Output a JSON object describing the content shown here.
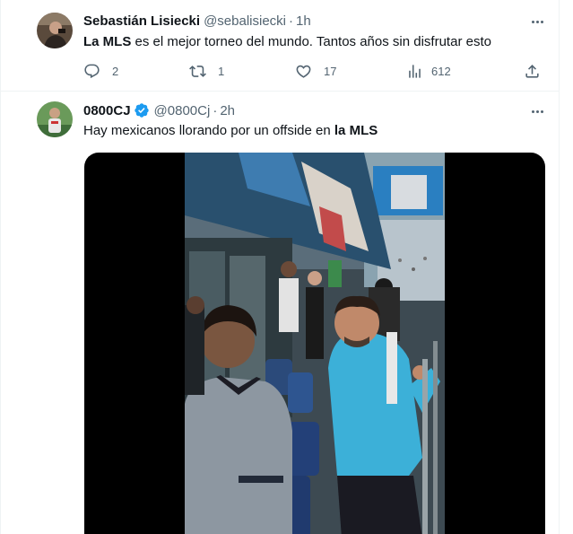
{
  "tweets": [
    {
      "name": "Sebastián Lisiecki",
      "handle": "@sebalisiecki",
      "separator": "·",
      "time": "1h",
      "text_bold": "La MLS",
      "text_rest": " es el mejor torneo del mundo. Tantos años sin disfrutar esto",
      "avatar_icon": "avatar-photo",
      "actions": {
        "reply_count": "2",
        "retweet_count": "1",
        "like_count": "17",
        "views_count": "612"
      }
    },
    {
      "name": "0800CJ",
      "verified": true,
      "handle": "@0800Cj",
      "separator": "·",
      "time": "2h",
      "text_rest": "Hay mexicanos llorando por un offside en ",
      "text_bold": "la MLS",
      "avatar_icon": "avatar-photo",
      "media": "video-stadium-fan-scene"
    }
  ],
  "colors": {
    "text": "#0f1419",
    "secondary": "#536471",
    "verified": "#1d9bf0",
    "divider": "#eff3f4"
  }
}
